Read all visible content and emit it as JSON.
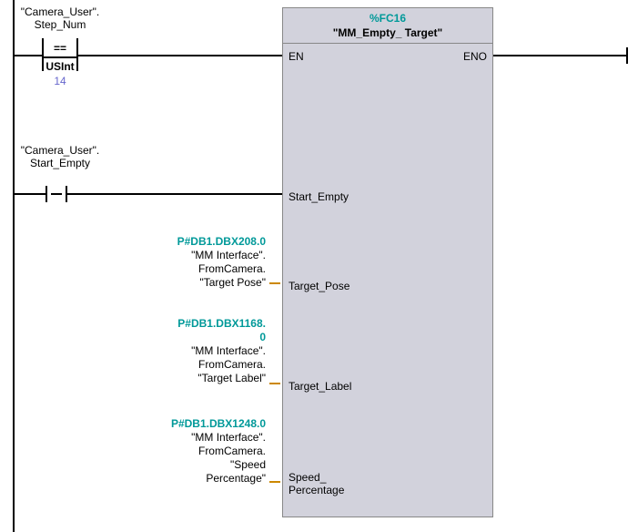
{
  "rail1": {
    "tag_db": "\"Camera_User\".",
    "tag_name": "Step_Num",
    "cmp_op": "==",
    "cmp_type": "USInt",
    "cmp_value": "14"
  },
  "rail2": {
    "tag_db": "\"Camera_User\".",
    "tag_name": "Start_Empty"
  },
  "block": {
    "id": "%FC16",
    "name": "\"MM_Empty_ Target\"",
    "pin_en": "EN",
    "pin_eno": "ENO",
    "pin_start_empty": "Start_Empty",
    "pin_target_pose": "Target_Pose",
    "pin_target_label": "Target_Label",
    "pin_speed_percentage_l1": "Speed_",
    "pin_speed_percentage_l2": "Percentage"
  },
  "op_target_pose": {
    "addr": "P#DB1.DBX208.0",
    "l1": "\"MM Interface\".",
    "l2": "FromCamera.",
    "l3": "\"Target Pose\""
  },
  "op_target_label": {
    "addr_l1": "P#DB1.DBX1168.",
    "addr_l2": "0",
    "l1": "\"MM Interface\".",
    "l2": "FromCamera.",
    "l3": "\"Target Label\""
  },
  "op_speed": {
    "addr": "P#DB1.DBX1248.0",
    "l1": "\"MM Interface\".",
    "l2": "FromCamera.",
    "l3": "\"Speed",
    "l4": "Percentage\""
  }
}
